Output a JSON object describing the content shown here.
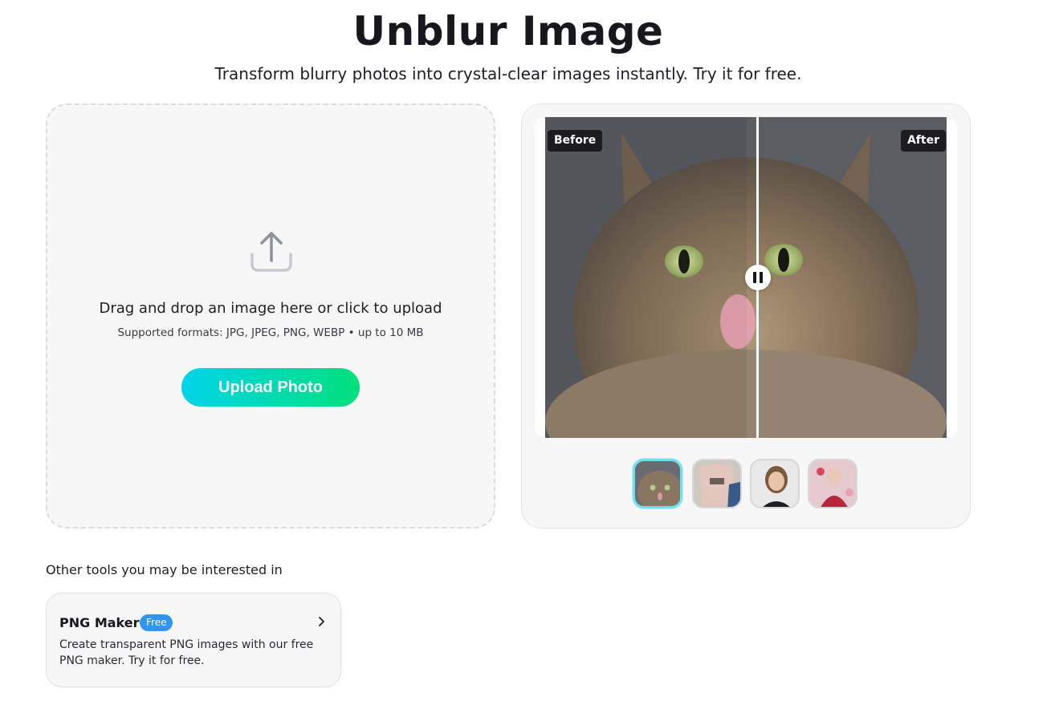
{
  "header": {
    "title": "Unblur Image",
    "subtitle": "Transform blurry photos into crystal-clear images instantly. Try it for free."
  },
  "upload": {
    "icon": "upload-icon",
    "main_text": "Drag and drop an image here or click to upload",
    "hint_text": "Supported formats: JPG, JPEG, PNG, WEBP • up to 10 MB",
    "button_label": "Upload Photo",
    "button_gradient": [
      "#00d4ea",
      "#00e07c"
    ]
  },
  "compare": {
    "before_label": "Before",
    "after_label": "After",
    "control_icon": "pause-icon",
    "thumbnails": [
      {
        "name": "cat",
        "selected": true
      },
      {
        "name": "t-shirts",
        "selected": false
      },
      {
        "name": "portrait",
        "selected": false
      },
      {
        "name": "costume",
        "selected": false
      }
    ]
  },
  "tools": {
    "heading": "Other tools you may be interested in",
    "items": [
      {
        "name": "PNG Maker",
        "badge": "Free",
        "badge_color": "#2f95f0",
        "description": "Create transparent PNG images with our free PNG maker. Try it for free.",
        "icon": "chevron-right-icon"
      }
    ]
  }
}
